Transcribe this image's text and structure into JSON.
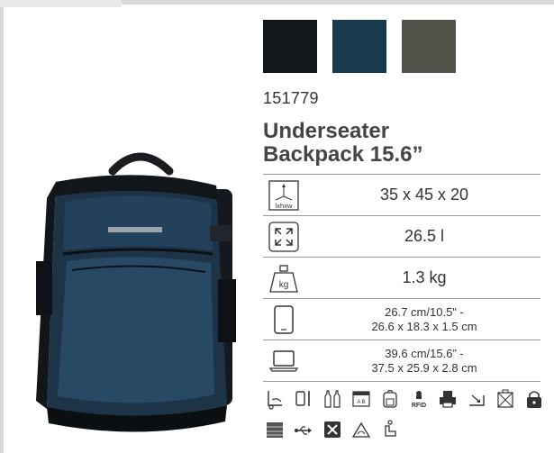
{
  "product": {
    "sku": "151779",
    "title_line1": "Underseater",
    "title_line2": "Backpack 15.6”"
  },
  "colors": [
    {
      "name": "black",
      "hex": "#14171a"
    },
    {
      "name": "navy-blue",
      "hex": "#173a4f"
    },
    {
      "name": "olive-grey",
      "hex": "#515249"
    }
  ],
  "specs": {
    "dimensions": {
      "icon": "dimensions-icon",
      "icon_label": "lxhxw",
      "value": "35 x 45 x 20"
    },
    "volume": {
      "icon": "volume-icon",
      "value": "26.5 l"
    },
    "weight": {
      "icon": "weight-icon",
      "icon_label": "kg",
      "value": "1.3 kg"
    },
    "tablet": {
      "icon": "tablet-icon",
      "line1": "26.7 cm/10.5\" -",
      "line2": "26.6 x 18.3 x 1.5 cm"
    },
    "laptop": {
      "icon": "laptop-icon",
      "line1": "39.6 cm/15.6” -",
      "line2": "37.5 x 25.9 x 2.8 cm"
    }
  },
  "features": {
    "row1": [
      "trolley-sleeve-icon",
      "phone-pocket-icon",
      "bottle-pocket-icon",
      "ab-badge-icon",
      "backpack-icon",
      "rfid-icon",
      "printer-icon",
      "expand-icon",
      "security-icon",
      "lock-icon"
    ],
    "row2": [
      "ventilated-back-icon",
      "usb-icon",
      "no-cut-icon",
      "eco-recycle-icon",
      "seat-icon"
    ],
    "rfid_label": "RFID",
    "ab_label": "A B"
  }
}
